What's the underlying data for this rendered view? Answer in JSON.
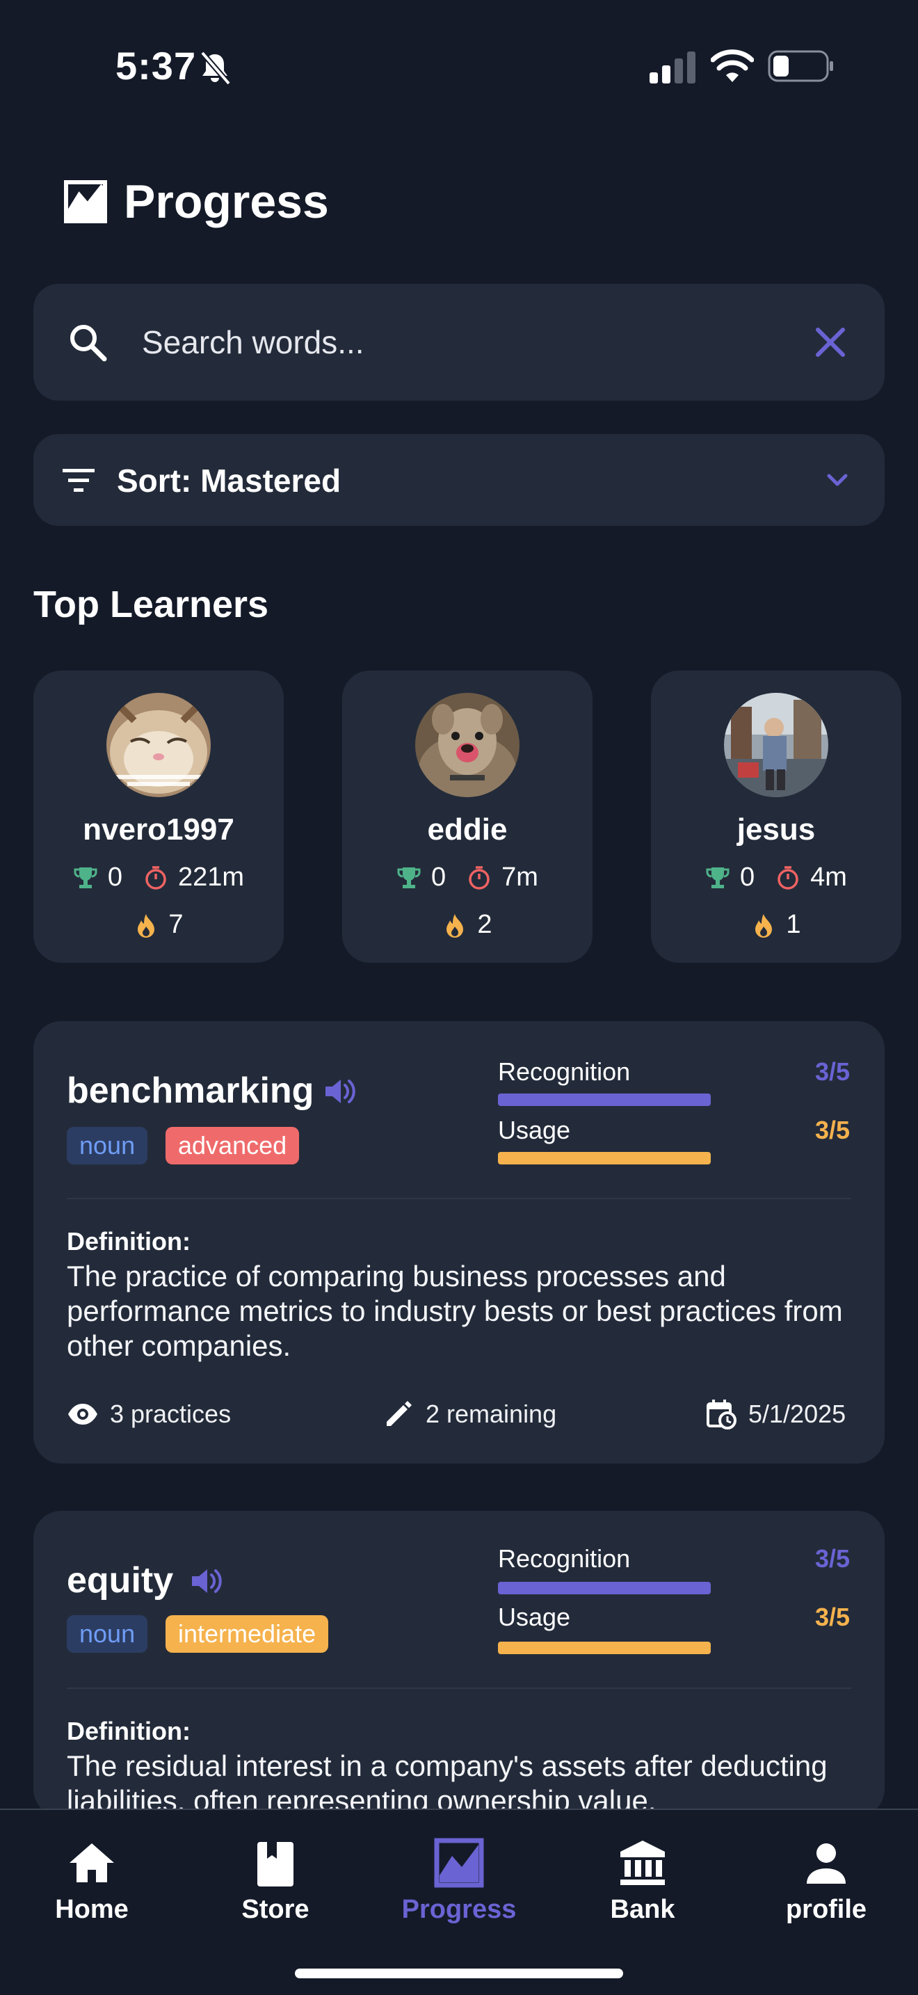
{
  "status_bar": {
    "time": "5:37"
  },
  "header": {
    "title": "Progress"
  },
  "search": {
    "placeholder": "Search words..."
  },
  "sort": {
    "label": "Sort: Mastered"
  },
  "top_learners": {
    "title": "Top Learners",
    "learners": [
      {
        "name": "nvero1997",
        "trophies": "0",
        "minutes": "221m",
        "streak": "7",
        "avatar": "kitten-photo"
      },
      {
        "name": "eddie",
        "trophies": "0",
        "minutes": "7m",
        "streak": "2",
        "avatar": "dog-photo"
      },
      {
        "name": "jesus",
        "trophies": "0",
        "minutes": "4m",
        "streak": "1",
        "avatar": "street-photo"
      }
    ]
  },
  "words": [
    {
      "word": "benchmarking",
      "part_of_speech": "noun",
      "level": "advanced",
      "recognition_label": "Recognition",
      "recognition_value": "3/5",
      "usage_label": "Usage",
      "usage_value": "3/5",
      "definition_label": "Definition:",
      "definition": "The practice of comparing business processes and performance metrics to industry bests or best practices from other companies.",
      "practices": "3 practices",
      "remaining": "2 remaining",
      "date": "5/1/2025"
    },
    {
      "word": "equity",
      "part_of_speech": "noun",
      "level": "intermediate",
      "recognition_label": "Recognition",
      "recognition_value": "3/5",
      "usage_label": "Usage",
      "usage_value": "3/5",
      "definition_label": "Definition:",
      "definition": "The residual interest in a company's assets after deducting liabilities, often representing ownership value."
    }
  ],
  "progress": {
    "recognition": 0.6,
    "usage": 0.6
  },
  "nav": {
    "home": "Home",
    "store": "Store",
    "progress": "Progress",
    "bank": "Bank",
    "profile": "profile"
  },
  "colors": {
    "background": "#141a28",
    "card": "#232b3a",
    "accent_purple": "#6a63d3",
    "accent_orange": "#f5b24d",
    "danger_red": "#ef6b6b",
    "trophy_green": "#4fb38a",
    "timer_red": "#f06363"
  }
}
